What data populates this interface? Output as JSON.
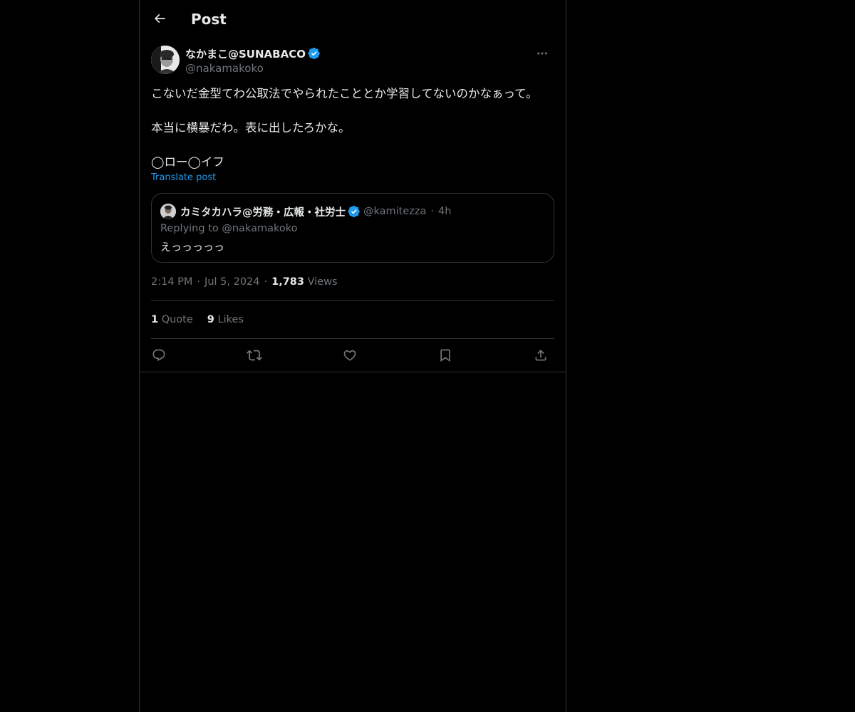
{
  "header": {
    "title": "Post",
    "back_icon": "arrow-left-icon"
  },
  "author": {
    "display_name": "なかまこ@SUNABACO",
    "handle": "@nakamakoko",
    "verified": true
  },
  "post": {
    "lines": [
      "こないだ金型てわ公取法でやられたこととか学習してないのかなぁって。",
      "本当に横暴だわ。表に出したろかな。",
      "◯ロー◯イフ"
    ],
    "translate_label": "Translate post"
  },
  "quote": {
    "display_name": "カミタカハラ@労務・広報・社労士",
    "handle": "@kamitezza",
    "separator": "·",
    "time": "4h",
    "replying_to": "Replying to @nakamakoko",
    "text": "えっっっっっ"
  },
  "meta": {
    "time": "2:14 PM",
    "date": "Jul 5, 2024",
    "separator": "·",
    "views_count": "1,783",
    "views_label": "Views"
  },
  "stats": {
    "quotes_count": "1",
    "quotes_label": "Quote",
    "likes_count": "9",
    "likes_label": "Likes"
  },
  "actions": [
    "reply-icon",
    "repost-icon",
    "like-icon",
    "bookmark-icon",
    "share-icon"
  ],
  "colors": {
    "background": "#000000",
    "text": "#e7e9ea",
    "muted": "#71767b",
    "border": "#2f3336",
    "accent": "#1d9bf0"
  }
}
